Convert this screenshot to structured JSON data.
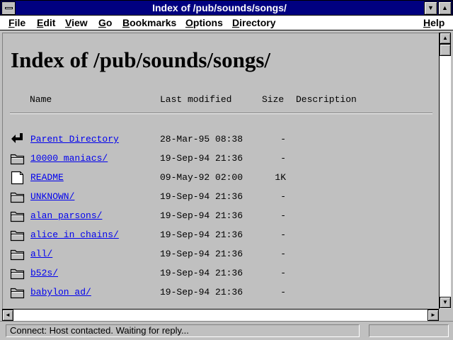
{
  "window": {
    "title": "Index of /pub/sounds/songs/",
    "minimize_glyph": "▼",
    "maximize_glyph": "▲"
  },
  "menu": [
    "File",
    "Edit",
    "View",
    "Go",
    "Bookmarks",
    "Options",
    "Directory",
    "Help"
  ],
  "page": {
    "title": "Index of /pub/sounds/songs/",
    "columns": {
      "name": "Name",
      "last_modified": "Last modified",
      "size": "Size",
      "description": "Description"
    },
    "entries": [
      {
        "icon": "back-arrow-icon",
        "name": "Parent Directory",
        "date": "28-Mar-95 08:38",
        "size": "-"
      },
      {
        "icon": "folder-icon",
        "name": "10000 maniacs/",
        "date": "19-Sep-94 21:36",
        "size": "-"
      },
      {
        "icon": "document-icon",
        "name": "README",
        "date": "09-May-92 02:00",
        "size": "1K"
      },
      {
        "icon": "folder-icon",
        "name": "UNKNOWN/",
        "date": "19-Sep-94 21:36",
        "size": "-"
      },
      {
        "icon": "folder-icon",
        "name": "alan parsons/",
        "date": "19-Sep-94 21:36",
        "size": "-"
      },
      {
        "icon": "folder-icon",
        "name": "alice in chains/",
        "date": "19-Sep-94 21:36",
        "size": "-"
      },
      {
        "icon": "folder-icon",
        "name": "all/",
        "date": "19-Sep-94 21:36",
        "size": "-"
      },
      {
        "icon": "folder-icon",
        "name": "b52s/",
        "date": "19-Sep-94 21:36",
        "size": "-"
      },
      {
        "icon": "folder-icon",
        "name": "babylon ad/",
        "date": "19-Sep-94 21:36",
        "size": "-"
      }
    ]
  },
  "status": {
    "text": "Connect: Host contacted. Waiting for reply..."
  },
  "colors": {
    "title_bar": "#000080",
    "link": "#0000ee",
    "background": "#c0c0c0"
  }
}
